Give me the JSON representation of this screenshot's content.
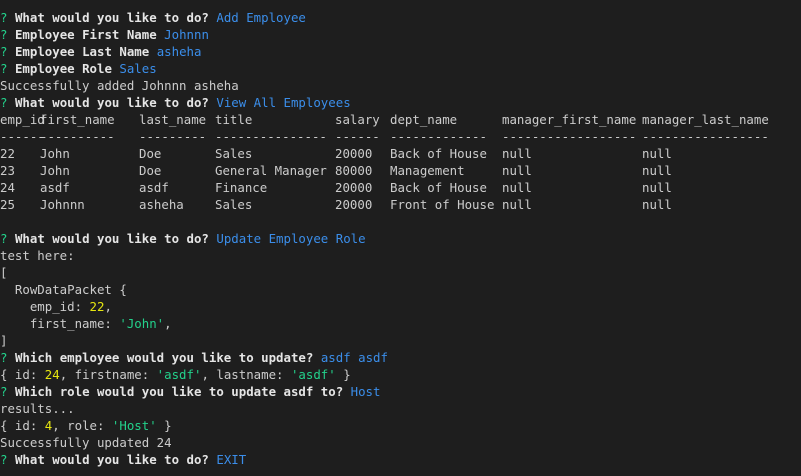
{
  "prompts": {
    "marker": "?",
    "what_to_do": "What would you like to do?",
    "first_name": "Employee First Name",
    "last_name": "Employee Last Name",
    "role": "Employee Role",
    "which_employee": "Which employee would you like to update?",
    "which_role": "Which role would you like to update asdf to?"
  },
  "answers": {
    "action_1": "Add Employee",
    "first_name": "Johnnn",
    "last_name": "asheha",
    "role": "Sales",
    "action_2": "View All Employees",
    "action_3": "Update Employee Role",
    "employee": "asdf asdf",
    "new_role": "Host",
    "action_4": "EXIT"
  },
  "messages": {
    "added": "Successfully added Johnnn asheha",
    "test_here": "test here:",
    "open_bracket": "[",
    "close_bracket": "]",
    "row_packet_open": "  RowDataPacket {",
    "results": "results...",
    "updated": "Successfully updated 24"
  },
  "row_packet": {
    "emp_id_key": "    emp_id: ",
    "emp_id_val": "22",
    "first_name_key": "    first_name: ",
    "first_name_val": "'John'"
  },
  "selected_employee": {
    "open": "{ id: ",
    "id": "24",
    "fn_key": ", firstname: ",
    "fn_val": "'asdf'",
    "ln_key": ", lastname: ",
    "ln_val": "'asdf'",
    "close": " }"
  },
  "selected_role": {
    "open": "{ id: ",
    "id": "4",
    "role_key": ", role: ",
    "role_val": "'Host'",
    "close": " }"
  },
  "table": {
    "headers": [
      "emp_id",
      "first_name",
      "last_name",
      "title",
      "salary",
      "dept_name",
      "manager_first_name",
      "manager_last_name"
    ],
    "separators": [
      "------",
      "----------",
      "---------",
      "---------------",
      "------",
      "-------------",
      "------------------",
      "-----------------"
    ],
    "rows": [
      [
        "22",
        "John",
        "Doe",
        "Sales",
        "20000",
        "Back of House",
        "null",
        "null"
      ],
      [
        "23",
        "John",
        "Doe",
        "General Manager",
        "80000",
        "Management",
        "null",
        "null"
      ],
      [
        "24",
        "asdf",
        "asdf",
        "Finance",
        "20000",
        "Back of House",
        "null",
        "null"
      ],
      [
        "25",
        "Johnnn",
        "asheha",
        "Sales",
        "20000",
        "Front of House",
        "null",
        "null"
      ]
    ]
  },
  "colors": {
    "background": "#1e1e1e",
    "text": "#cccccc",
    "prompt_marker": "#23d18b",
    "answer": "#3b8eea",
    "number": "#e5e510",
    "string": "#23d18b"
  }
}
